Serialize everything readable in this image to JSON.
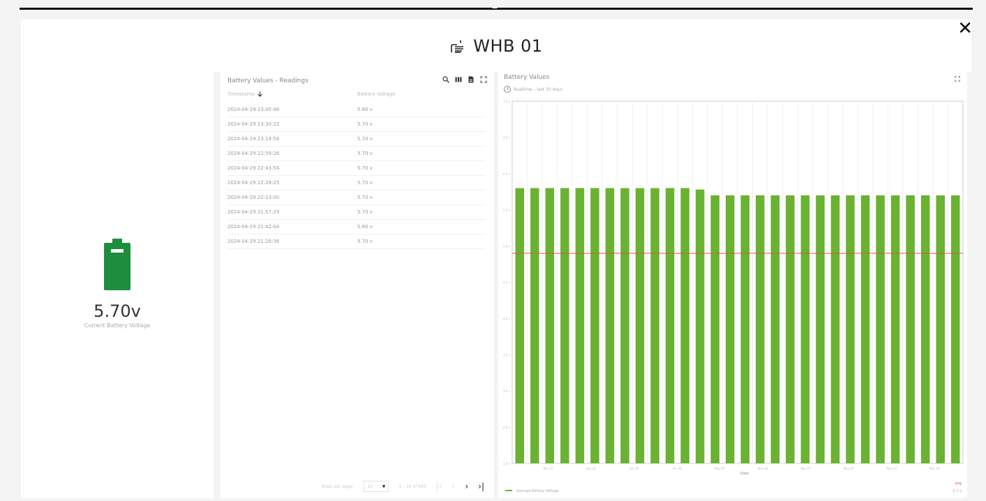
{
  "dialog": {
    "title": "WHB 01"
  },
  "status_panel": {
    "voltage": "5.70v",
    "voltage_label": "Current Battery Voltage",
    "battery_color": "#1e8e3e"
  },
  "readings_table": {
    "title": "Battery Values - Readings",
    "columns": [
      "Timestamp",
      "Battery Voltage"
    ],
    "rows": [
      [
        "2024-04-29 23:45:48",
        "5.80 v"
      ],
      [
        "2024-04-29 23:30:22",
        "5.70 v"
      ],
      [
        "2024-04-29 23:14:54",
        "5.70 v"
      ],
      [
        "2024-04-29 22:59:26",
        "5.70 v"
      ],
      [
        "2024-04-29 22:43:54",
        "5.70 v"
      ],
      [
        "2024-04-29 22:28:25",
        "5.70 v"
      ],
      [
        "2024-04-29 22:13:00",
        "5.70 v"
      ],
      [
        "2024-04-29 21:57:29",
        "5.70 v"
      ],
      [
        "2024-04-29 21:42:04",
        "5.80 v"
      ],
      [
        "2024-04-29 21:26:36",
        "5.70 v"
      ]
    ],
    "pagination": {
      "rows_per_page_label": "Rows per page:",
      "rows_per_page": "10",
      "range": "1 – 10 of 699"
    },
    "toolbar_icons": [
      "search-icon",
      "columns-icon",
      "export-icon",
      "fullscreen-icon"
    ]
  },
  "chart_panel": {
    "title": "Battery Values",
    "subtitle": "Realtime – last 30 days",
    "legend": "Average Battery Voltage",
    "legend_right": "avg",
    "legend_right_value": "5.7 v",
    "bar_color": "#6ab232",
    "threshold_color": "#e05050"
  },
  "chart_data": {
    "type": "bar",
    "title": "Battery Values",
    "xlabel": "Date",
    "ylabel": "",
    "ylim": [
      2.0,
      7.0
    ],
    "yticks": [
      "2.0 v",
      "2.5 v",
      "3.0 v",
      "3.5 v",
      "4.0 v",
      "4.5 v",
      "5.0 v",
      "5.5 v",
      "6.0 v",
      "6.5 v",
      "7.0 v"
    ],
    "xticks": [
      "Mar 31",
      "Apr 22",
      "Apr 25",
      "Apr 28",
      "May 01",
      "May 04",
      "May 07",
      "May 10",
      "May 13",
      "May 16"
    ],
    "values": [
      5.8,
      5.8,
      5.8,
      5.8,
      5.8,
      5.8,
      5.8,
      5.8,
      5.8,
      5.8,
      5.8,
      5.8,
      5.78,
      5.7,
      5.7,
      5.7,
      5.7,
      5.7,
      5.7,
      5.7,
      5.7,
      5.7,
      5.7,
      5.7,
      5.7,
      5.7,
      5.7,
      5.7,
      5.7,
      5.7
    ],
    "threshold": 4.9,
    "series": [
      {
        "name": "Average Battery Voltage"
      }
    ]
  }
}
